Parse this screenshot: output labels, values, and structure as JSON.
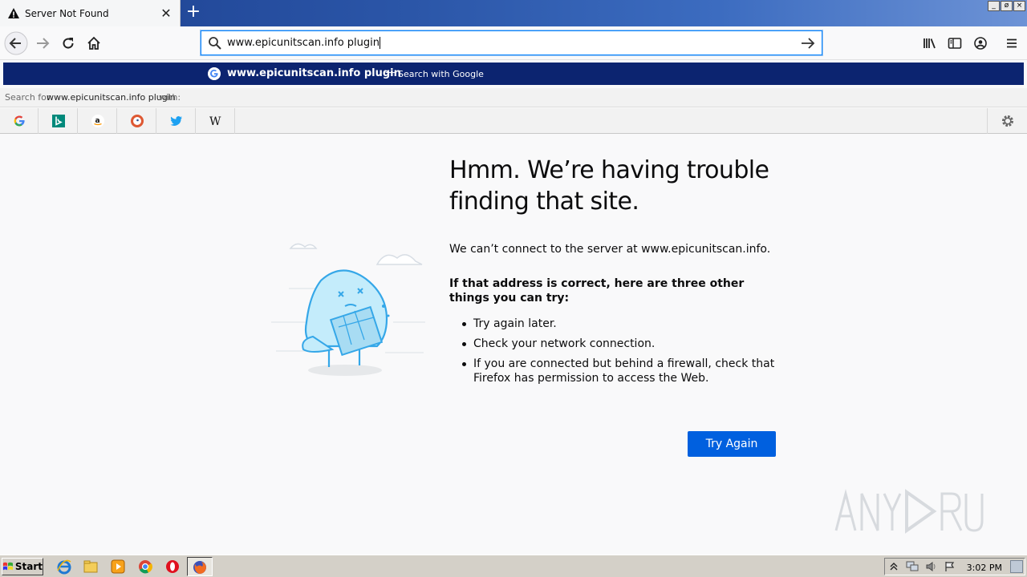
{
  "tab": {
    "title": "Server Not Found"
  },
  "window_buttons": [
    "_",
    "ø",
    "×"
  ],
  "urlbar": {
    "value": "www.epicunitscan.info plugin"
  },
  "suggestion": {
    "query": "www.epicunitscan.info plugin",
    "separator": "—",
    "engine_text": "Search with Google"
  },
  "search_for": {
    "prefix": "Search for ",
    "query": "www.epicunitscan.info plugin",
    "suffix": " with:"
  },
  "search_engines": [
    "google",
    "bing",
    "amazon",
    "duckduckgo",
    "twitter",
    "wikipedia"
  ],
  "error": {
    "title": "Hmm. We’re having trouble finding that site.",
    "message": "We can’t connect to the server at www.epicunitscan.info.",
    "hint": "If that address is correct, here are three other things you can try:",
    "suggestions": [
      "Try again later.",
      "Check your network connection.",
      "If you are connected but behind a firewall, check that Firefox has permission to access the Web."
    ],
    "button": "Try Again"
  },
  "taskbar": {
    "start": "Start",
    "clock": "3:02 PM"
  },
  "colors": {
    "accent": "#0060df",
    "suggest_bg": "#0c2470",
    "titlebar": "#2b56a8"
  }
}
